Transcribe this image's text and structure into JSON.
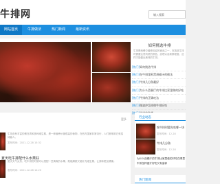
{
  "header": {
    "logo": "牛排网",
    "search_placeholder": "输入搜索"
  },
  "nav": {
    "items": [
      "网站首页",
      "牛排做法",
      "热门新闻",
      "最新资讯"
    ]
  },
  "featured": {
    "title": "如何挑选牛排",
    "desc": "牛排是西餐中最受欢迎的食品之一，在挑选牛排时需要注意肉质的颜色、纹理以及新鲜程度，这样才能做出美味的牛排。",
    "list": [
      {
        "tag": "[热门]",
        "text": "如何挑选牛排"
      },
      {
        "tag": "[热门]",
        "text": "在牛排里煎黑胡椒汁的做法"
      },
      {
        "tag": "[热门]",
        "text": "牛排几分熟最好"
      },
      {
        "tag": "[热门]",
        "text": "为什么西餐厅的牛排比家里做的好吃"
      },
      {
        "tag": "[热门]",
        "text": "牛排的正确吃法"
      },
      {
        "tag": "[热门]",
        "text": "微波炉怎样做牛排好吃"
      },
      {
        "tag": "[热门]",
        "text": "牛排的种类"
      }
    ]
  },
  "latest": {
    "more": "更多",
    "articles": [
      {
        "title": "",
        "desc": "牛排含有丰富的蛋白质和多种维生素，是一种营养价值很高的食物，在西方国家非常流行，人们常常用它来招待客人。",
        "meta": "发布时间：2021-12-28 15:32"
      },
      {
        "title": "夏天吃牛排配什么水果好",
        "desc": "夏天天气炎热，吃牛排的时候可以搭配一些清爽的水果，既能解腻又能补充维生素，让美味更加健康。",
        "meta": "发布时间：2021-12-28 14:20"
      }
    ]
  },
  "hot_news": {
    "title": "行业动态",
    "items": [
      {
        "title": "吃牛排时要先吃哪一块",
        "meta": "发布时间：12-28"
      },
      {
        "title": "牛排几分熟",
        "meta": "发布时间：12-28"
      }
    ],
    "wide_item": "为什么西餐厅的牛排比家里做的好吃在哪里",
    "wide_item2": "牛排怎样做才好吃又有营养"
  },
  "popular": {
    "title": "热门新闻"
  }
}
